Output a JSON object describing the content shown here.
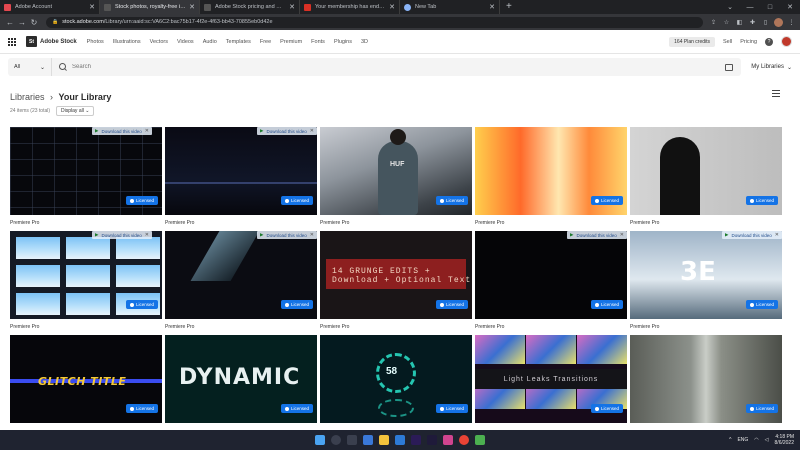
{
  "browser": {
    "tabs": [
      {
        "title": "Adobe Account",
        "favicon_color": "#e34850",
        "active": false
      },
      {
        "title": "Stock photos, royalty-free images",
        "favicon_color": "#2c2c2c",
        "active": true
      },
      {
        "title": "Adobe Stock pricing and membe",
        "favicon_color": "#2c2c2c",
        "active": false
      },
      {
        "title": "Your membership has ended - b",
        "favicon_color": "#d93025",
        "active": false
      },
      {
        "title": "New Tab",
        "favicon_color": "#8ab4f8",
        "active": false
      }
    ],
    "new_tab": "+",
    "address": {
      "host": "stock.adobe.com",
      "path": "/Library/urn:aaid:sc:VA6C2:bac75b17-4f2e-4f63-bb43-70855eb0d42e"
    }
  },
  "header": {
    "logo_mark": "St",
    "logo_text": "Adobe Stock",
    "nav": [
      "Photos",
      "Illustrations",
      "Vectors",
      "Videos",
      "Audio",
      "Templates",
      "Free",
      "Premium",
      "Fonts",
      "Plugins",
      "3D"
    ],
    "credits": "164 Plan credits",
    "sell": "Sell",
    "pricing": "Pricing",
    "help": "?"
  },
  "search": {
    "scope": "All",
    "placeholder": "Search",
    "my_libraries": "My Libraries"
  },
  "breadcrumb": {
    "root": "Libraries",
    "separator": "›",
    "current": "Your Library"
  },
  "subinfo": {
    "count": "24 items (23 total)",
    "display": "Display all"
  },
  "download_label": "Download this video",
  "licensed_label": "Licensed",
  "items": [
    {
      "caption": "Premiere Pro",
      "download_bar": true
    },
    {
      "caption": "Premiere Pro",
      "download_bar": true
    },
    {
      "caption": "Premiere Pro",
      "download_bar": false,
      "huf": "HUF"
    },
    {
      "caption": "Premiere Pro",
      "download_bar": false
    },
    {
      "caption": "Premiere Pro",
      "download_bar": false
    },
    {
      "caption": "Premiere Pro",
      "download_bar": true
    },
    {
      "caption": "Premiere Pro",
      "download_bar": true
    },
    {
      "caption": "Premiere Pro",
      "download_bar": false,
      "text": "14 GRUNGE EDITS + Download + Optional Text"
    },
    {
      "caption": "Premiere Pro",
      "download_bar": true
    },
    {
      "caption": "Premiere Pro",
      "download_bar": true,
      "text": "3E"
    },
    {
      "caption": "",
      "download_bar": false,
      "text": "GLITCH TITLE"
    },
    {
      "caption": "",
      "download_bar": false,
      "text": "DYNAMIC"
    },
    {
      "caption": "",
      "download_bar": false,
      "text": "58"
    },
    {
      "caption": "",
      "download_bar": false,
      "text": "Light Leaks Transitions"
    },
    {
      "caption": "",
      "download_bar": false
    }
  ],
  "taskbar": {
    "time": "4:18 PM",
    "date": "8/6/2022",
    "lang": "ENG"
  }
}
